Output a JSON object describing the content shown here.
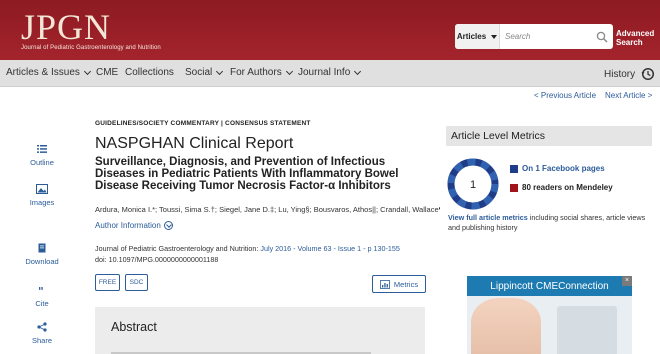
{
  "header": {
    "logo_text": "JPGN",
    "logo_subtitle": "Journal of Pediatric Gastroenterology and Nutrition",
    "search": {
      "scope": "Articles",
      "placeholder": "Search"
    },
    "advanced_search": "Advanced Search"
  },
  "nav": {
    "items": [
      {
        "label": "Articles & Issues"
      },
      {
        "label": "CME"
      },
      {
        "label": "Collections"
      },
      {
        "label": "Social"
      },
      {
        "label": "For Authors"
      },
      {
        "label": "Journal Info"
      }
    ],
    "history": "History"
  },
  "pager": {
    "prev": "< Previous Article",
    "next": "Next Article >"
  },
  "tools": {
    "outline": "Outline",
    "images": "Images",
    "download": "Download",
    "cite": "Cite",
    "share": "Share"
  },
  "article": {
    "kicker": "GUIDELINES/SOCIETY COMMENTARY | CONSENSUS STATEMENT",
    "title": "NASPGHAN Clinical Report",
    "subtitle": "Surveillance, Diagnosis, and Prevention of Infectious Diseases in Pediatric Patients With Inflammatory Bowel Disease Receiving Tumor Necrosis Factor-α Inhibitors",
    "authors": "Ardura, Monica I.*; Toussi, Sima S.†; Siegel, Jane D.‡; Lu, Ying§; Bousvaros, Athos||; Crandall, Wallace¶",
    "author_information": "Author Information",
    "citation_journal": "Journal of Pediatric Gastroenterology and Nutrition:",
    "citation_issue": "July 2016 - Volume 63 - Issue 1 - p 130-155",
    "doi": "doi: 10.1097/MPG.0000000000001188",
    "tags": [
      "FREE",
      "SDC"
    ],
    "metrics_button": "Metrics",
    "abstract_heading": "Abstract"
  },
  "metrics": {
    "heading": "Article Level Metrics",
    "score": "1",
    "facebook": "On 1 Facebook pages",
    "mendeley": "80 readers on Mendeley",
    "full_link": "View full article metrics",
    "full_rest": " including social shares, article views and publishing history",
    "facebook_color": "#1f3c88",
    "mendeley_color": "#a0141c"
  },
  "ad": {
    "brand": "Lippincott",
    "product": "CMEConnection"
  }
}
